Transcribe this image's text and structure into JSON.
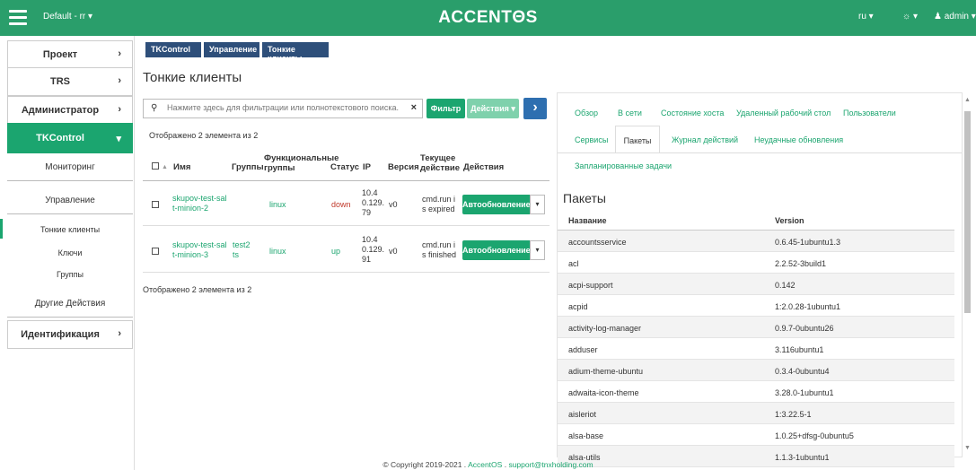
{
  "header": {
    "project": "Default - rr ▾",
    "brand": "ACCENTΘS",
    "lang": "ru ▾",
    "theme": "☼ ▾",
    "user": "admin ▾"
  },
  "sidebar": {
    "items": [
      {
        "label": "Проект",
        "chev": "›"
      },
      {
        "label": "TRS",
        "chev": "›"
      },
      {
        "label": "Администратор",
        "chev": "›"
      },
      {
        "label": "TKControl",
        "chev": "▾"
      }
    ],
    "sub": [
      "Мониторинг",
      "Управление",
      "Тонкие клиенты",
      "Ключи",
      "Группы",
      "Другие Действия"
    ],
    "ident": {
      "label": "Идентификация",
      "chev": "›"
    }
  },
  "breadcrumb": [
    "TKControl",
    "Управление",
    "Тонкие клиенты"
  ],
  "page_title": "Тонкие клиенты",
  "search": {
    "placeholder": "Нажмите здесь для фильтрации или полнотекстового поиска.",
    "clear": "×"
  },
  "toolbar": {
    "filter": "Фильтр",
    "actions": "Действия ▾",
    "next": "›"
  },
  "count_text": "Отображено 2 элемента из 2",
  "table": {
    "headers": {
      "name": "Имя",
      "sort": "▲",
      "groups": "Группы",
      "fgroups": "Функциональные группы",
      "status": "Статус",
      "ip": "IP",
      "version": "Версия",
      "action": "Текущее действие",
      "actions": "Действия"
    },
    "rows": [
      {
        "name1": "skupov-test-sal",
        "name2": "t-minion-2",
        "g1": "",
        "g2": "",
        "fg": "linux",
        "status": "down",
        "ip1": "10.4",
        "ip2": "0.129.",
        "ip3": "79",
        "ver": "v0",
        "act1": "cmd.run i",
        "act2": "s expired",
        "btn": "Автообновление",
        "caret": "▾"
      },
      {
        "name1": "skupov-test-sal",
        "name2": "t-minion-3",
        "g1": "test2",
        "g2": "ts",
        "fg": "linux",
        "status": "up",
        "ip1": "10.4",
        "ip2": "0.129.",
        "ip3": "91",
        "ver": "v0",
        "act1": "cmd.run i",
        "act2": "s finished",
        "btn": "Автообновление",
        "caret": "▾"
      }
    ]
  },
  "tabs": [
    "Обзор",
    "В сети",
    "Состояние хоста",
    "Удаленный рабочий стол",
    "Пользователи",
    "Сервисы",
    "Пакеты",
    "Журнал действий",
    "Неудачные обновления",
    "Запланированные задачи"
  ],
  "packages": {
    "title": "Пакеты",
    "col_name": "Название",
    "col_version": "Version",
    "rows": [
      {
        "name": "accountsservice",
        "version": "0.6.45-1ubuntu1.3"
      },
      {
        "name": "acl",
        "version": "2.2.52-3build1"
      },
      {
        "name": "acpi-support",
        "version": "0.142"
      },
      {
        "name": "acpid",
        "version": "1:2.0.28-1ubuntu1"
      },
      {
        "name": "activity-log-manager",
        "version": "0.9.7-0ubuntu26"
      },
      {
        "name": "adduser",
        "version": "3.116ubuntu1"
      },
      {
        "name": "adium-theme-ubuntu",
        "version": "0.3.4-0ubuntu4"
      },
      {
        "name": "adwaita-icon-theme",
        "version": "3.28.0-1ubuntu1"
      },
      {
        "name": "aisleriot",
        "version": "1:3.22.5-1"
      },
      {
        "name": "alsa-base",
        "version": "1.0.25+dfsg-0ubuntu5"
      },
      {
        "name": "alsa-utils",
        "version": "1.1.3-1ubuntu1"
      }
    ]
  },
  "footer": {
    "copy": "© Copyright 2019-2021 .",
    "brand": "AccentOS",
    "email": "support@tnxholding.com"
  },
  "colors": {
    "green": "#2a9e6b",
    "accent": "#1ba56f",
    "navy": "#2e4f7a",
    "down": "#c0392b"
  }
}
